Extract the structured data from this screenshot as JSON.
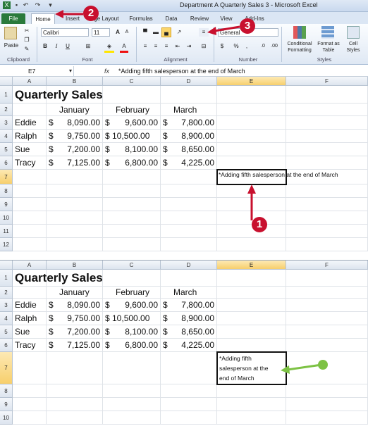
{
  "window_title": "Department A Quarterly Sales 3 - Microsoft Excel",
  "tabs": [
    "File",
    "Home",
    "Insert",
    "Page Layout",
    "Formulas",
    "Data",
    "Review",
    "View",
    "Add-Ins"
  ],
  "ribbon": {
    "paste": "Paste",
    "font_name": "Calibri",
    "font_size": "11",
    "number_format": "General",
    "groups": [
      "Clipboard",
      "Font",
      "Alignment",
      "Number",
      "Styles"
    ],
    "styles_buttons": [
      "Conditional Formatting",
      "Format as Table",
      "Cell Styles"
    ]
  },
  "formula_bar": {
    "name_box": "E7",
    "fx": "fx",
    "content": "*Adding fifth salesperson at the end of March"
  },
  "columns": [
    "A",
    "B",
    "C",
    "D",
    "E",
    "F"
  ],
  "sheet": {
    "title": "Quarterly Sales",
    "months": [
      "January",
      "February",
      "March"
    ],
    "rows": [
      {
        "name": "Eddie",
        "jan": "8,090.00",
        "feb": "9,600.00",
        "mar": "7,800.00"
      },
      {
        "name": "Ralph",
        "jan": "9,750.00",
        "feb": "$ 10,500.00",
        "mar": "8,900.00"
      },
      {
        "name": "Sue",
        "jan": "7,200.00",
        "feb": "8,100.00",
        "mar": "8,650.00"
      },
      {
        "name": "Tracy",
        "jan": "7,125.00",
        "feb": "6,800.00",
        "mar": "4,225.00"
      }
    ],
    "currency": "$",
    "note": "*Adding fifth salesperson at the end of March",
    "note_wrapped": [
      "*Adding fifth",
      "salesperson at the",
      "end of March"
    ]
  },
  "row_numbers_top": [
    "1",
    "2",
    "3",
    "4",
    "5",
    "6",
    "7",
    "8",
    "9",
    "10",
    "11",
    "12"
  ],
  "row_numbers_bottom": [
    "1",
    "2",
    "3",
    "4",
    "5",
    "6",
    "7",
    "8",
    "9",
    "10"
  ],
  "callouts": [
    "1",
    "2",
    "3"
  ],
  "colors": {
    "callout": "#c8102e",
    "green_arrow": "#7dc244",
    "file_tab": "#2a7a3c",
    "selection": "#111111"
  }
}
